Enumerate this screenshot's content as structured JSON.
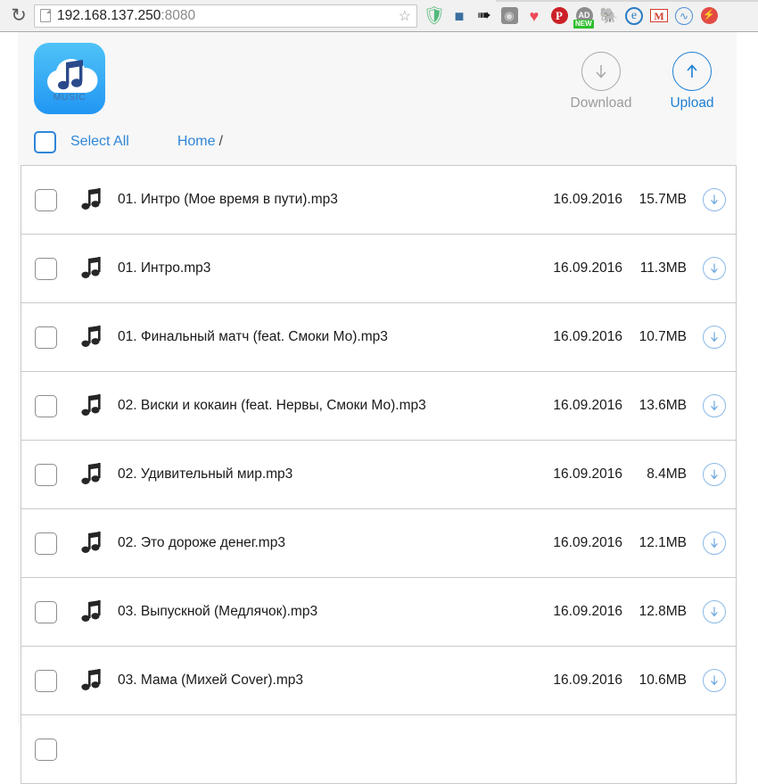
{
  "browser": {
    "reload_icon": "reload-icon",
    "url": "192.168.137.250",
    "url_port": ":8080",
    "page_icon": "page-document-icon",
    "star_icon": "☆",
    "extensions": [
      {
        "name": "adguard-shield-icon",
        "glyph": "✓"
      },
      {
        "name": "stack-layers-icon",
        "glyph": "≡"
      },
      {
        "name": "flag-icon",
        "glyph": "⚑"
      },
      {
        "name": "gray-target-icon",
        "glyph": "◎"
      },
      {
        "name": "heart-icon",
        "glyph": "♥"
      },
      {
        "name": "pinterest-icon",
        "glyph": "P"
      },
      {
        "name": "adblock-icon",
        "glyph": "AD",
        "badge": "NEW"
      },
      {
        "name": "evernote-elephant-icon",
        "glyph": "◖"
      },
      {
        "name": "browser-e-icon",
        "glyph": "e"
      },
      {
        "name": "gmail-icon",
        "glyph": "M"
      },
      {
        "name": "swirl-sync-icon",
        "glyph": "∿"
      },
      {
        "name": "red-plug-icon",
        "glyph": "⚡"
      }
    ]
  },
  "app": {
    "logo_text": "MUSIC",
    "logo_color_start": "#4fc3f7",
    "logo_color_end": "#2196f3",
    "actions": {
      "download": {
        "label": "Download",
        "icon": "arrow-down-circle-icon",
        "color": "#9b9b9b",
        "enabled": false
      },
      "upload": {
        "label": "Upload",
        "icon": "arrow-up-circle-icon",
        "color": "#1e7fd4",
        "enabled": true
      }
    },
    "select_all_label": "Select All",
    "breadcrumb": {
      "home": "Home",
      "separator": "/"
    },
    "accent_color": "#2f86d8"
  },
  "files": [
    {
      "name": "01. Интро (Мое время в пути).mp3",
      "date": "16.09.2016",
      "size": "15.7MB"
    },
    {
      "name": "01. Интро.mp3",
      "date": "16.09.2016",
      "size": "11.3MB"
    },
    {
      "name": "01. Финальный матч (feat. Смоки Мо).mp3",
      "date": "16.09.2016",
      "size": "10.7MB"
    },
    {
      "name": "02. Виски и кокаин (feat. Нервы, Смоки Мо).mp3",
      "date": "16.09.2016",
      "size": "13.6MB"
    },
    {
      "name": "02. Удивительный мир.mp3",
      "date": "16.09.2016",
      "size": "8.4MB"
    },
    {
      "name": "02. Это дороже денег.mp3",
      "date": "16.09.2016",
      "size": "12.1MB"
    },
    {
      "name": "03. Выпускной (Медлячок).mp3",
      "date": "16.09.2016",
      "size": "12.8MB"
    },
    {
      "name": "03. Мама (Михей Cover).mp3",
      "date": "16.09.2016",
      "size": "10.6MB"
    },
    {
      "name": "",
      "date": "",
      "size": ""
    }
  ]
}
